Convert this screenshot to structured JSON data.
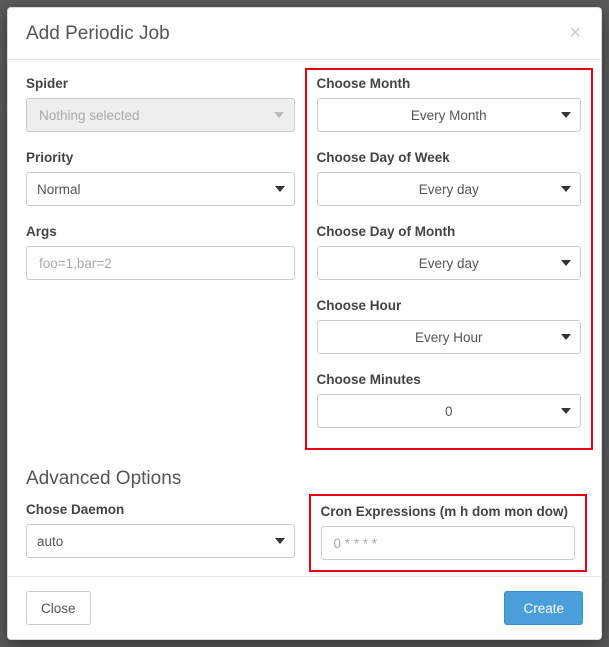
{
  "modal": {
    "title": "Add Periodic Job",
    "close_glyph": "×"
  },
  "left": {
    "spider": {
      "label": "Spider",
      "value": "Nothing selected"
    },
    "priority": {
      "label": "Priority",
      "value": "Normal"
    },
    "args": {
      "label": "Args",
      "placeholder": "foo=1,bar=2"
    }
  },
  "right": {
    "month": {
      "label": "Choose Month",
      "value": "Every Month"
    },
    "dow": {
      "label": "Choose Day of Week",
      "value": "Every day"
    },
    "dom": {
      "label": "Choose Day of Month",
      "value": "Every day"
    },
    "hour": {
      "label": "Choose Hour",
      "value": "Every Hour"
    },
    "minutes": {
      "label": "Choose Minutes",
      "value": "0"
    }
  },
  "advanced": {
    "title": "Advanced Options",
    "daemon": {
      "label": "Chose Daemon",
      "value": "auto"
    },
    "cron": {
      "label": "Cron Expressions (m h dom mon dow)",
      "placeholder": "0 * * * *"
    }
  },
  "footer": {
    "close": "Close",
    "create": "Create"
  }
}
